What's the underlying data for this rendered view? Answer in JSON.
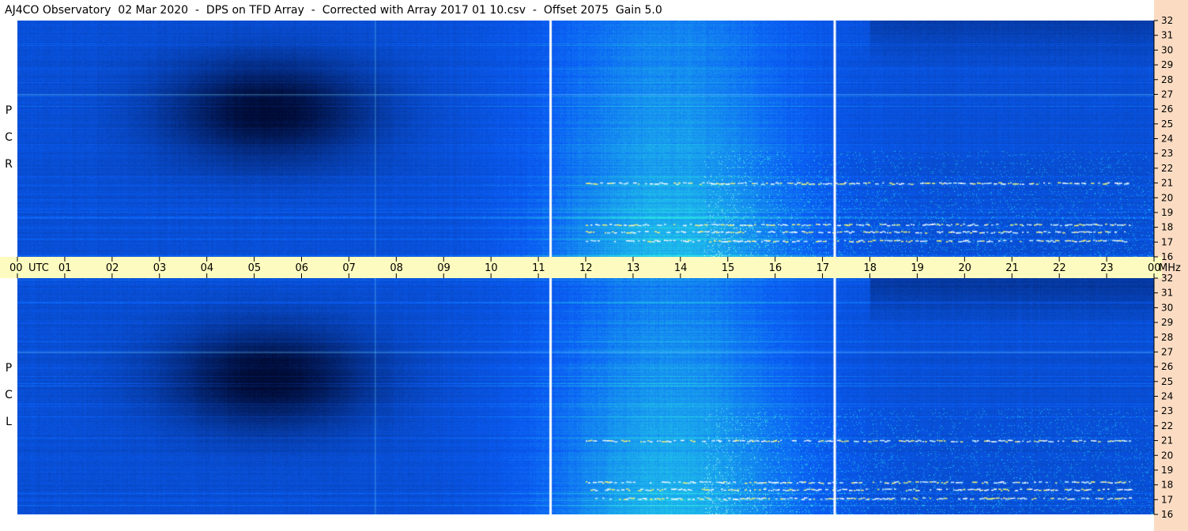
{
  "title": "AJ4CO Observatory  02 Mar 2020  -  DPS on TFD Array  -  Corrected with Array 2017 01 10.csv  -  Offset 2075  Gain 5.0",
  "panels": [
    {
      "label_letters": [
        "P",
        "C",
        "R"
      ]
    },
    {
      "label_letters": [
        "P",
        "C",
        "L"
      ]
    }
  ],
  "time_axis": {
    "labels": [
      "00",
      "01",
      "02",
      "03",
      "04",
      "05",
      "06",
      "07",
      "08",
      "09",
      "10",
      "11",
      "12",
      "13",
      "14",
      "15",
      "16",
      "17",
      "18",
      "19",
      "20",
      "21",
      "22",
      "23",
      "00"
    ],
    "utc_label": "UTC",
    "unit_label": "MHz"
  },
  "chart_data": {
    "type": "heatmap",
    "title": "AJ4CO Observatory  02 Mar 2020  -  DPS on TFD Array  -  Corrected with Array 2017 01 10.csv  -  Offset 2075  Gain 5.0",
    "x": {
      "label": "UTC",
      "range": [
        0,
        24
      ],
      "ticks": [
        "00",
        "01",
        "02",
        "03",
        "04",
        "05",
        "06",
        "07",
        "08",
        "09",
        "10",
        "11",
        "12",
        "13",
        "14",
        "15",
        "16",
        "17",
        "18",
        "19",
        "20",
        "21",
        "22",
        "23",
        "00"
      ]
    },
    "y": {
      "label": "MHz",
      "range": [
        16,
        32
      ],
      "ticks": [
        "16",
        "17",
        "18",
        "19",
        "20",
        "21",
        "22",
        "23",
        "24",
        "25",
        "26",
        "27",
        "28",
        "29",
        "30",
        "31",
        "32"
      ]
    },
    "series": [
      {
        "name": "RCP"
      },
      {
        "name": "LCP"
      }
    ],
    "data_gaps_utc": [
      11.25,
      17.25
    ],
    "colors": {
      "low": "#000a33",
      "mid": "#0a5cf5",
      "high": "#28e6e6",
      "peak": "#ffffff",
      "title_bg": "#ffffff",
      "time_axis_bg": "#fdfbbf",
      "freq_axis_bg": "#fbdcc2"
    }
  }
}
